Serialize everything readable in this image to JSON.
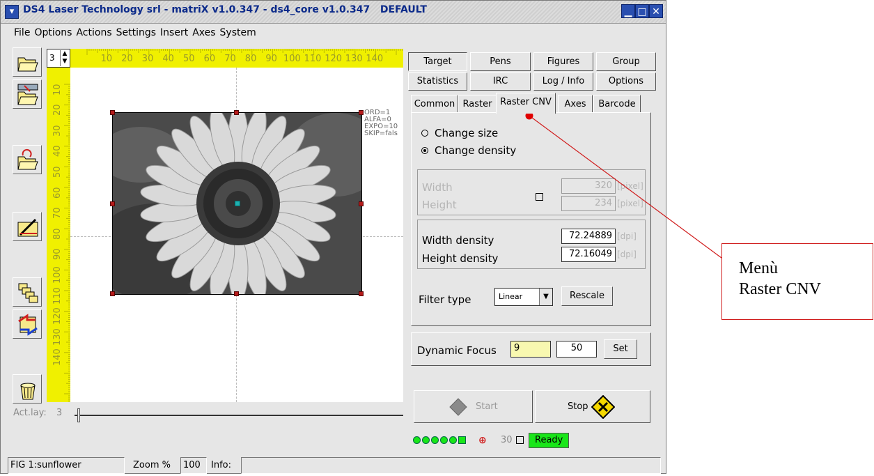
{
  "window": {
    "title": "DS4 Laser Technology srl - matriX v1.0.347 - ds4_core v1.0.347   DEFAULT",
    "controls": [
      "minimize-icon",
      "maximize-icon",
      "close-icon"
    ]
  },
  "menu": [
    "File",
    "Options",
    "Actions",
    "Settings",
    "Insert",
    "Axes",
    "System"
  ],
  "toolbar": {
    "icons": [
      "open-folder-icon",
      "open-folder-export-icon",
      "reload-folder-icon",
      "draw-pencil-icon",
      "layers-icon",
      "swap-arrows-icon",
      "trash-icon"
    ]
  },
  "layer_spinner": {
    "value": "3"
  },
  "ruler": {
    "top": [
      "10",
      "20",
      "30",
      "40",
      "50",
      "60",
      "70",
      "80",
      "90",
      "100",
      "110",
      "120",
      "130",
      "140"
    ],
    "left": [
      "10",
      "20",
      "30",
      "40",
      "50",
      "60",
      "70",
      "80",
      "90",
      "100",
      "110",
      "120",
      "130",
      "140"
    ]
  },
  "figure": {
    "params": [
      "ORD=1",
      "ALFA=0",
      "EXPO=10",
      "SKIP=fals"
    ]
  },
  "actlay": {
    "label": "Act.lay:",
    "value": "3"
  },
  "tabs_row1": [
    "Target",
    "Pens",
    "Figures",
    "Group"
  ],
  "tabs_row2": [
    "Statistics",
    "IRC",
    "Log / Info",
    "Options"
  ],
  "subtabs": [
    "Common",
    "Raster",
    "Raster CNV",
    "Axes",
    "Barcode"
  ],
  "selected_subtab": "Raster CNV",
  "raster_cnv": {
    "radio_change_size": "Change size",
    "radio_change_density": "Change density",
    "width_label": "Width",
    "height_label": "Height",
    "width_value": "320",
    "height_value": "234",
    "pixel_unit": "[pixel]",
    "width_density_label": "Width density",
    "height_density_label": "Height density",
    "width_density_value": "72.24889",
    "height_density_value": "72.16049",
    "dpi_unit": "[dpi]",
    "filter_label": "Filter type",
    "filter_value": "Linear",
    "rescale_label": "Rescale"
  },
  "dynamic_focus": {
    "label": "Dynamic Focus",
    "value1": "9",
    "value2": "50",
    "set_label": "Set"
  },
  "start_label": "Start",
  "stop_label": "Stop",
  "status_indicators": {
    "count": "30",
    "ready": "Ready"
  },
  "statusbar": {
    "fig_label": "FIG",
    "fig_value": "1:sunflower",
    "zoom_label": "Zoom %",
    "zoom_value": "100",
    "info_label": "Info:"
  },
  "annotation": {
    "line1": "Menù",
    "line2": "Raster CNV"
  },
  "colors": {
    "ruler": "#f0f000",
    "ready": "#19e619",
    "annotation": "#d01c1c"
  }
}
